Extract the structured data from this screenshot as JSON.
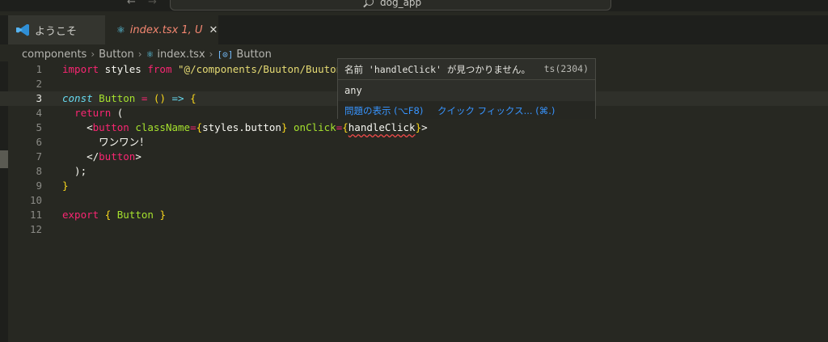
{
  "titlebar": {
    "title": "dog_app",
    "back_icon": "←",
    "forward_icon": "→"
  },
  "tabs": [
    {
      "label": "ようこそ"
    },
    {
      "label": "index.tsx",
      "status": "1, U",
      "close": "✕"
    }
  ],
  "breadcrumb": [
    "components",
    "Button",
    "index.tsx",
    "Button"
  ],
  "editor": {
    "line_numbers": [
      "1",
      "2",
      "3",
      "4",
      "5",
      "6",
      "7",
      "8",
      "9",
      "10",
      "11",
      "12"
    ],
    "current_line": 3
  },
  "hover": {
    "message": "名前 'handleClick' が見つかりません。",
    "code": "ts(2304)",
    "type": "any",
    "action_view_problem": "問題の表示 (⌥F8)",
    "action_quick_fix": "クイック フィックス... (⌘.)"
  },
  "colors": {
    "error": "#f14c4c",
    "link": "#3794ff",
    "background": "#272822"
  }
}
